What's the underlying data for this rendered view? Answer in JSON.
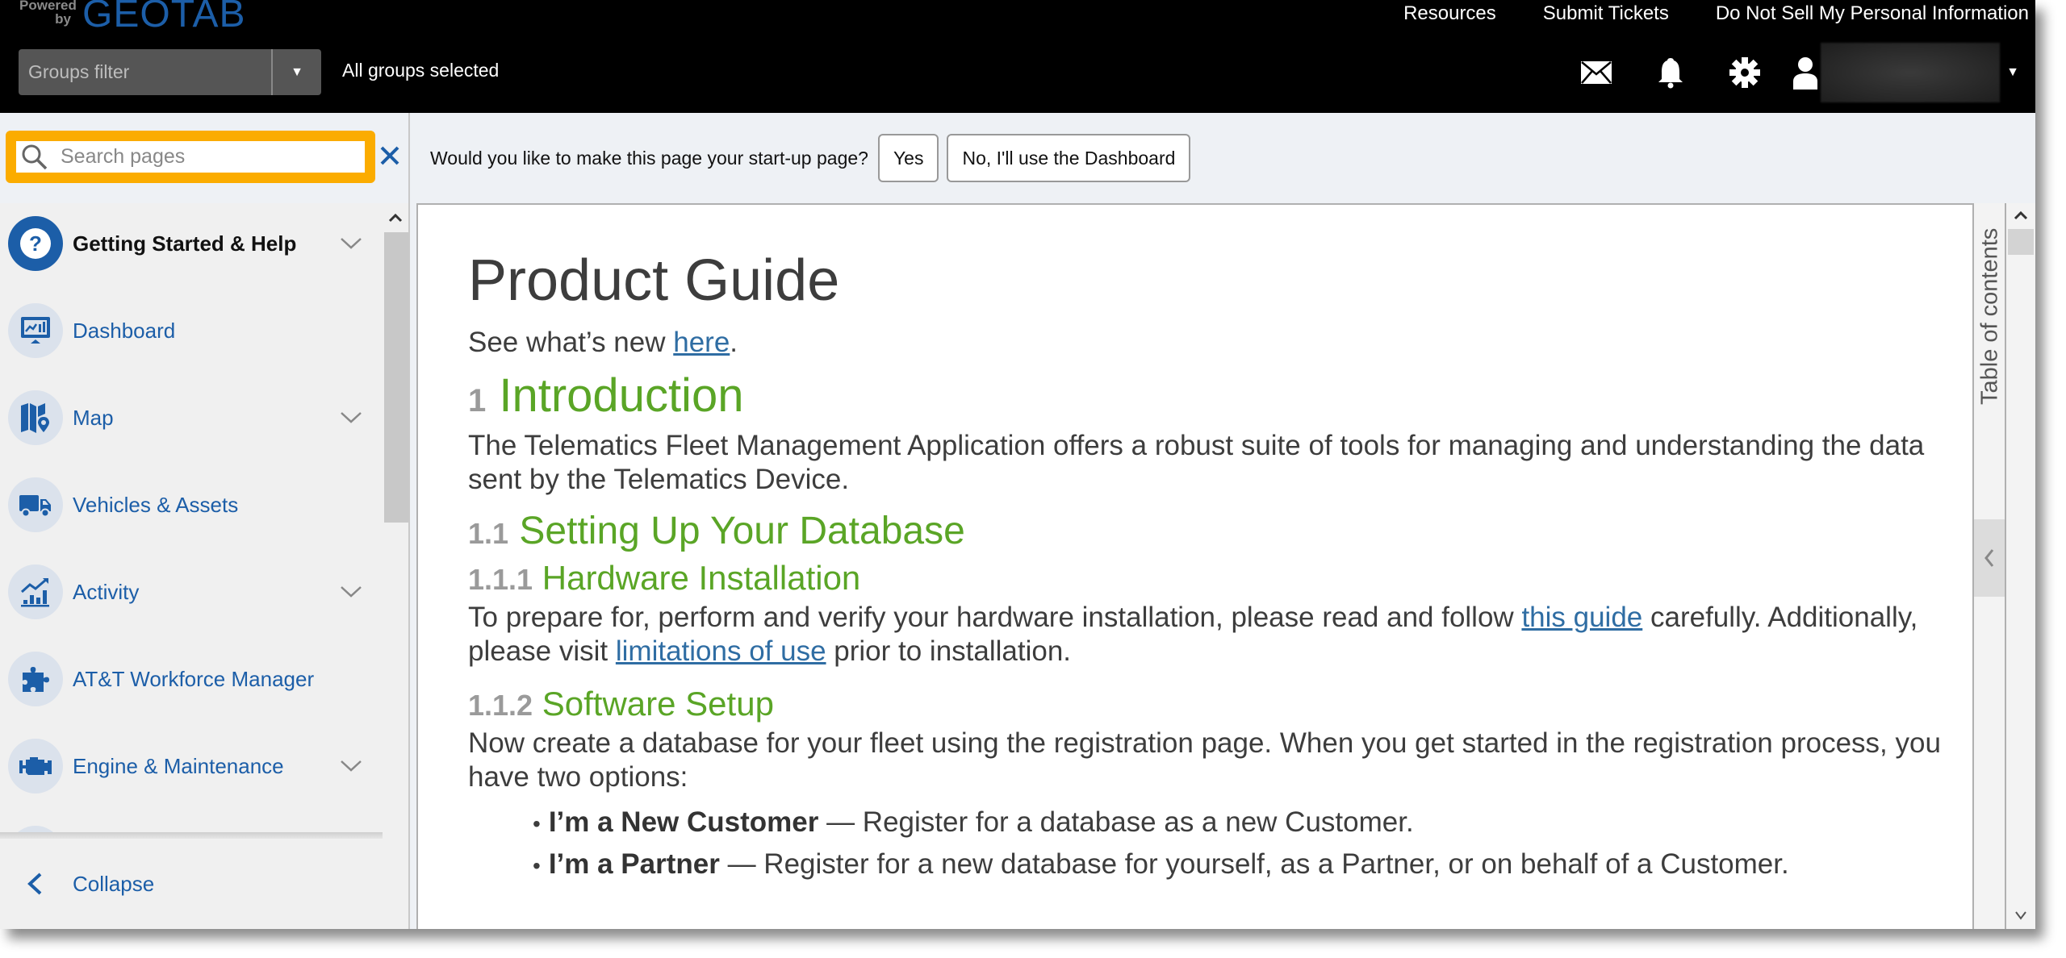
{
  "header": {
    "logo_powered_by": "Powered by",
    "logo_brand": "GEOTAB",
    "top_links": [
      "Resources",
      "Submit Tickets",
      "Do Not Sell My Personal Information"
    ],
    "groups_filter": {
      "placeholder": "Groups filter",
      "status": "All groups selected"
    },
    "icons": [
      "mail-icon",
      "bell-icon",
      "gear-icon",
      "user-icon"
    ],
    "user_name": "[redacted]"
  },
  "nav": {
    "search": {
      "placeholder": "Search pages",
      "value": ""
    },
    "items": [
      {
        "label": "Getting Started & Help",
        "icon": "help-icon",
        "expandable": true,
        "active": true
      },
      {
        "label": "Dashboard",
        "icon": "dashboard-icon",
        "expandable": false
      },
      {
        "label": "Map",
        "icon": "map-icon",
        "expandable": true
      },
      {
        "label": "Vehicles & Assets",
        "icon": "truck-icon",
        "expandable": false
      },
      {
        "label": "Activity",
        "icon": "activity-icon",
        "expandable": true
      },
      {
        "label": "AT&T Workforce Manager",
        "icon": "puzzle-icon",
        "expandable": false
      },
      {
        "label": "Engine & Maintenance",
        "icon": "engine-icon",
        "expandable": true
      }
    ],
    "collapse_label": "Collapse"
  },
  "prompt": {
    "question": "Would you like to make this page your start-up page?",
    "yes_label": "Yes",
    "no_label": "No, I'll use the Dashboard"
  },
  "document": {
    "title": "Product Guide",
    "whats_new_prefix": "See what’s new ",
    "whats_new_link": "here",
    "whats_new_suffix": ".",
    "intro": {
      "num": "1",
      "title": "Introduction",
      "body": "The Telematics Fleet Management Application offers a robust suite of tools for managing and understanding the data sent by the Telematics Device."
    },
    "setup_db": {
      "num": "1.1",
      "title": "Setting Up Your Database"
    },
    "hardware": {
      "num": "1.1.1",
      "title": "Hardware Installation",
      "body_1": "To prepare for, perform and verify your hardware installation, please read and follow ",
      "link_1": "this guide",
      "body_2": " carefully. Additionally, please visit ",
      "link_2": "limitations of use",
      "body_3": " prior to installation."
    },
    "software": {
      "num": "1.1.2",
      "title": "Software Setup",
      "body": "Now create a database for your fleet using the registration page. When you get started in the registration process, you have two options:",
      "options": [
        {
          "bold": "I’m a New Customer",
          "text": " — Register for a database as a new Customer."
        },
        {
          "bold": "I’m a Partner",
          "text": " — Register for a new database for yourself, as a Partner, or on behalf of a Customer."
        }
      ]
    }
  },
  "toc": {
    "label": "Table of contents"
  },
  "colors": {
    "brand_blue": "#1c5ea8",
    "heading_green": "#5aa526",
    "search_highlight": "#fbac00",
    "link_blue": "#2f6da3"
  }
}
